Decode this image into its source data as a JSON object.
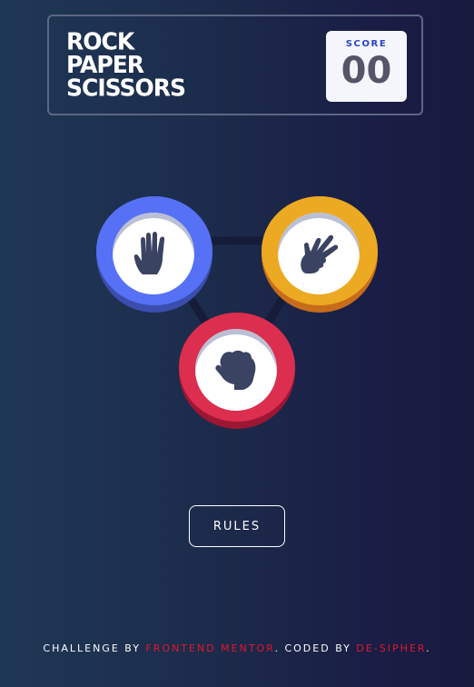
{
  "header": {
    "logo_lines": [
      "ROCK",
      "PAPER",
      "SCISSORS"
    ],
    "score_label": "SCORE",
    "score_value": "00"
  },
  "tokens": [
    {
      "name": "paper",
      "color": "#5671f5",
      "icon": "hand-paper-icon"
    },
    {
      "name": "scissors",
      "color": "#eca922",
      "icon": "hand-scissors-icon"
    },
    {
      "name": "rock",
      "color": "#dc2e4e",
      "icon": "hand-rock-icon"
    }
  ],
  "rules_button": {
    "label": "RULES"
  },
  "attribution": {
    "prefix": "CHALLENGE BY ",
    "author1": "FRONTEND MENTOR",
    "middle": ". CODED BY ",
    "author2": "DE-SIPHER",
    "suffix": "."
  },
  "colors": {
    "accent": "#e3152b",
    "icon": "#3b4363"
  }
}
